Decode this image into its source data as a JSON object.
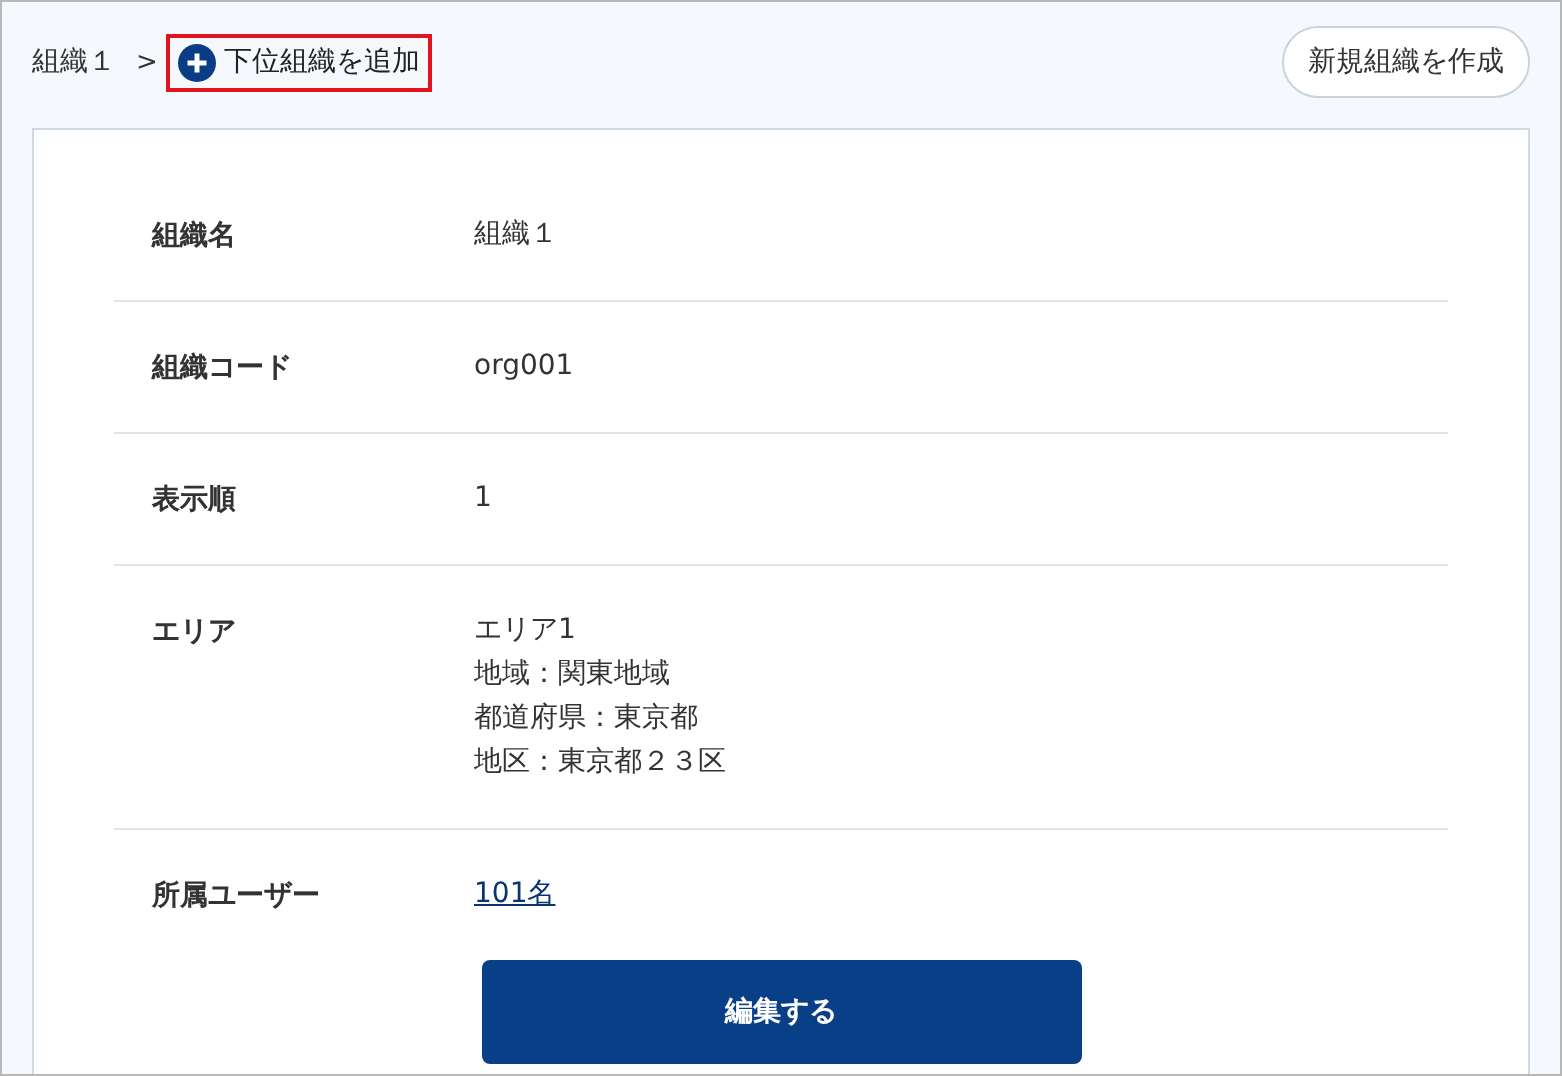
{
  "breadcrumb": {
    "current": "組織１",
    "separator": ">",
    "add_link": "下位組織を追加",
    "add_link_highlighted": true
  },
  "create_button": "新規組織を作成",
  "fields": [
    {
      "label": "組織名",
      "kind": "text",
      "value": "組織１"
    },
    {
      "label": "組織コード",
      "kind": "text",
      "value": "org001"
    },
    {
      "label": "表示順",
      "kind": "text",
      "value": "1"
    },
    {
      "label": "エリア",
      "kind": "lines",
      "lines": [
        "エリア1",
        "地域：関東地域",
        "都道府県：東京都",
        "地区：東京都２３区"
      ]
    },
    {
      "label": "所属ユーザー",
      "kind": "link",
      "value": "101名"
    }
  ],
  "edit_button": "編集する"
}
